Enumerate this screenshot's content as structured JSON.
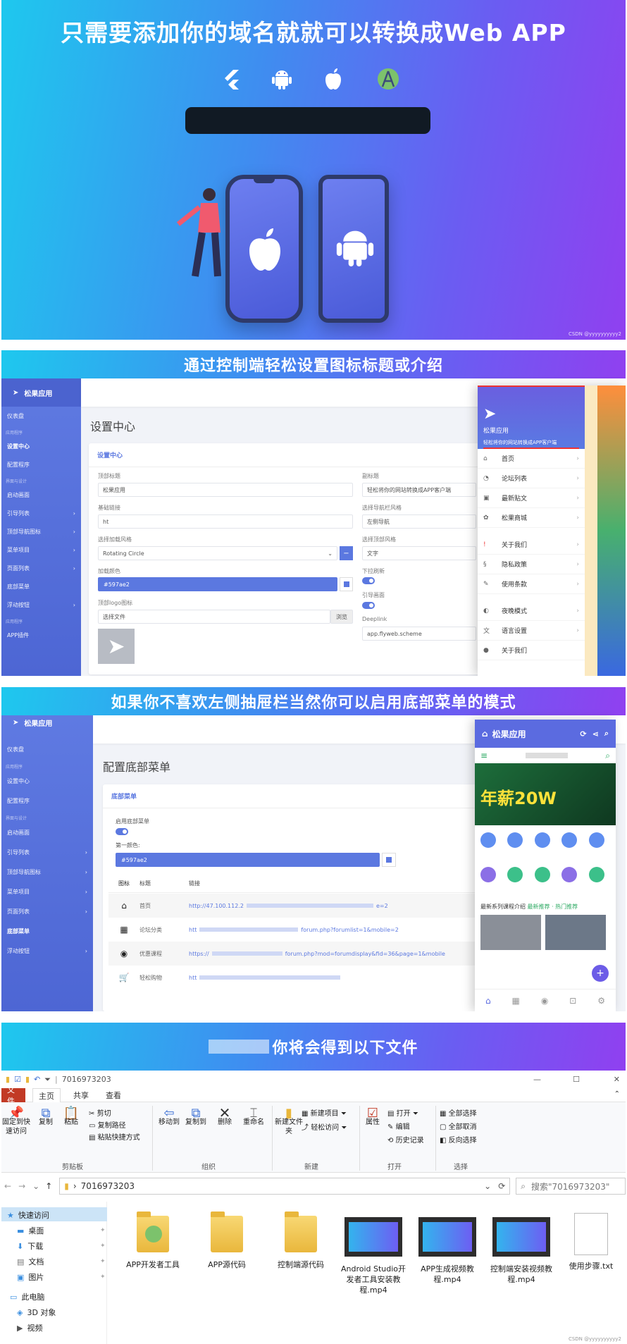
{
  "panel1": {
    "title": "只需要添加你的域名就就可以转换成Web APP",
    "platform_icons": [
      "flutter-icon",
      "android-icon",
      "apple-icon",
      "android-studio-icon"
    ],
    "watermark": "CSDN @yyyyyyyyyy2"
  },
  "panel2": {
    "banner": "通过控制端轻松设置图标标题或介绍",
    "sidebar": {
      "brand": "松果应用",
      "groups": [
        "应用程序",
        "界面与设计",
        "应用程序"
      ],
      "items": [
        "仪表盘",
        "设置中心",
        "配置程序",
        "启动画面",
        "引导列表",
        "顶部导航图标",
        "菜单项目",
        "页面列表",
        "底部菜单",
        "浮动按钮",
        "APP插件"
      ]
    },
    "page_title": "设置中心",
    "card_title": "设置中心",
    "fields": {
      "top_title_label": "顶部标题",
      "top_title_value": "松果应用",
      "subtitle_label": "副标题",
      "subtitle_value": "轻松将你的网站转换成APP客户端",
      "base_link_label": "基础链接",
      "base_link_value": "ht",
      "nav_style_label": "选择导航栏风格",
      "nav_style_value": "左侧导航",
      "loading_label": "选择加载风格",
      "loading_value": "Rotating Circle",
      "top_style_label": "选择顶部风格",
      "top_style_value": "文字",
      "loading_color_label": "加载颜色",
      "loading_color_value": "#597ae2",
      "pull_refresh_label": "下拉刷新",
      "logo_label": "顶部logo图标",
      "logo_placeholder": "选择文件",
      "browse": "浏览",
      "guide_label": "引导画面",
      "deeplink_label": "Deeplink",
      "deeplink_value": "app.flyweb.scheme"
    },
    "phone": {
      "app_name": "松果应用",
      "tagline": "轻松将你的网站转换成APP客户端",
      "menu": [
        "首页",
        "论坛列表",
        "最新贴文",
        "松果商城",
        "关于我们",
        "隐私政策",
        "使用条款",
        "夜晚模式",
        "语言设置",
        "关于我们"
      ]
    },
    "watermark": "CSDN @yyyyyyyyyy2"
  },
  "panel3": {
    "banner": "如果你不喜欢左侧抽屉栏当然你可以启用底部菜单的模式",
    "page_title": "配置底部菜单",
    "card_title": "底部菜单",
    "enable_label": "启用底部菜单",
    "color_label": "第一颜色:",
    "color_value": "#597ae2",
    "table_headers": [
      "图标",
      "标题",
      "链接"
    ],
    "rows": [
      {
        "icon": "⌂",
        "title": "首页",
        "link": "http://47.100.112.2",
        "tail": "e=2"
      },
      {
        "icon": "▦",
        "title": "论坛分类",
        "link": "htt",
        "tail": "forum.php?forumlist=1&mobile=2"
      },
      {
        "icon": "◉",
        "title": "优惠课程",
        "link": "https://",
        "tail": "forum.php?mod=forumdisplay&fid=36&page=1&mobile"
      },
      {
        "icon": "🛒",
        "title": "轻松购物",
        "link": "htt",
        "tail": ""
      }
    ],
    "phone": {
      "app_name": "松果应用",
      "banner_text": "年薪20W",
      "section_title": "最新系列课程介绍",
      "section_sub": "最新推荐 · 热门推荐"
    }
  },
  "panel4": {
    "banner": "你将会得到以下文件",
    "window_title": "7016973203",
    "tabs": [
      "文件",
      "主页",
      "共享",
      "查看"
    ],
    "ribbon": {
      "pin": "固定到快速访问",
      "copy": "复制",
      "paste": "粘贴",
      "cut": "剪切",
      "copy_path": "复制路径",
      "paste_shortcut": "粘贴快捷方式",
      "move_to": "移动到",
      "copy_to": "复制到",
      "delete": "删除",
      "rename": "重命名",
      "new_folder": "新建文件夹",
      "new_item": "新建项目",
      "easy_access": "轻松访问",
      "properties": "属性",
      "open": "打开",
      "edit": "编辑",
      "history": "历史记录",
      "select_all": "全部选择",
      "select_none": "全部取消",
      "invert": "反向选择",
      "groups": [
        "剪贴板",
        "组织",
        "新建",
        "打开",
        "选择"
      ]
    },
    "address": "7016973203",
    "search_placeholder": "搜索\"7016973203\"",
    "nav": [
      "快速访问",
      "桌面",
      "下载",
      "文档",
      "图片",
      "此电脑",
      "3D 对象",
      "视频"
    ],
    "files": [
      {
        "name": "APP开发者工具",
        "type": "folder-studio"
      },
      {
        "name": "APP源代码",
        "type": "folder"
      },
      {
        "name": "控制端源代码",
        "type": "folder"
      },
      {
        "name": "Android Studio开发者工具安装教程.mp4",
        "type": "video"
      },
      {
        "name": "APP生成视频教程.mp4",
        "type": "video"
      },
      {
        "name": "控制端安装视频教程.mp4",
        "type": "video"
      },
      {
        "name": "使用步骤.txt",
        "type": "txt"
      }
    ],
    "watermark": "CSDN @yyyyyyyyyy2"
  }
}
